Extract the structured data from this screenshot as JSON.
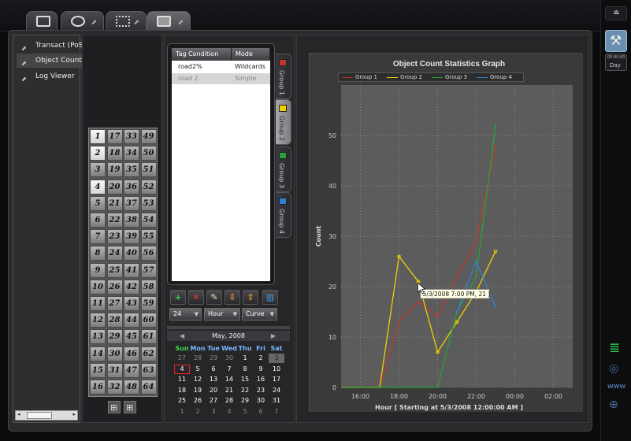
{
  "tabs": [
    {
      "id": "monitor",
      "icon": "monitor-icon",
      "active": false
    },
    {
      "id": "dashboard",
      "icon": "gauge-icon",
      "active": false
    },
    {
      "id": "network",
      "icon": "network-icon",
      "active": false
    },
    {
      "id": "window",
      "icon": "window-icon",
      "active": true
    }
  ],
  "sidebar": {
    "items": [
      {
        "label": "Transact (PoS"
      },
      {
        "label": "Object Count"
      },
      {
        "label": "Log Viewer"
      }
    ]
  },
  "channel_grid": [
    [
      "1",
      "17",
      "33",
      "49"
    ],
    [
      "2",
      "18",
      "34",
      "50"
    ],
    [
      "3",
      "19",
      "35",
      "51"
    ],
    [
      "4",
      "20",
      "36",
      "52"
    ],
    [
      "5",
      "21",
      "37",
      "53"
    ],
    [
      "6",
      "22",
      "38",
      "54"
    ],
    [
      "7",
      "23",
      "39",
      "55"
    ],
    [
      "8",
      "24",
      "40",
      "56"
    ],
    [
      "9",
      "25",
      "41",
      "57"
    ],
    [
      "10",
      "26",
      "42",
      "58"
    ],
    [
      "11",
      "27",
      "43",
      "59"
    ],
    [
      "12",
      "28",
      "44",
      "60"
    ],
    [
      "13",
      "29",
      "45",
      "61"
    ],
    [
      "14",
      "30",
      "46",
      "62"
    ],
    [
      "15",
      "31",
      "47",
      "63"
    ],
    [
      "16",
      "32",
      "48",
      "64"
    ]
  ],
  "tag_table": {
    "headers": [
      "Tag Condition",
      "Mode"
    ],
    "rows": [
      [
        "road2%",
        "Wildcards"
      ],
      [
        "road 2",
        "Simple"
      ]
    ]
  },
  "groups": [
    "Group 1",
    "Group 2",
    "Group 3",
    "Group 4"
  ],
  "group_colors": [
    "#c0392b",
    "#f0d000",
    "#27a33a",
    "#2f7fd8"
  ],
  "toolbar": {
    "dd_interval": "24",
    "dd_unit": "Hour",
    "dd_style": "Curve"
  },
  "calendar": {
    "month": "May, 2008",
    "dow": [
      "Sun",
      "Mon",
      "Tue",
      "Wed",
      "Thu",
      "Fri",
      "Sat"
    ],
    "weeks": [
      [
        "27",
        "28",
        "29",
        "30",
        "1",
        "2",
        "3"
      ],
      [
        "4",
        "5",
        "6",
        "7",
        "8",
        "9",
        "10"
      ],
      [
        "11",
        "12",
        "13",
        "14",
        "15",
        "16",
        "17"
      ],
      [
        "18",
        "19",
        "20",
        "21",
        "22",
        "23",
        "24"
      ],
      [
        "25",
        "26",
        "27",
        "28",
        "29",
        "30",
        "31"
      ],
      [
        "1",
        "2",
        "3",
        "4",
        "5",
        "6",
        "7"
      ]
    ]
  },
  "rightbar": {
    "clock": "00:00:00",
    "day": "Day"
  },
  "chart_data": {
    "type": "line",
    "title": "Object Count Statistics Graph",
    "xlabel": "Hour  [ Starting at 5/3/2008 12:00:00 AM ]",
    "ylabel": "Count",
    "x_ticks": [
      "16:00",
      "18:00",
      "20:00",
      "22:00",
      "00:00",
      "02:00"
    ],
    "y_ticks": [
      "0",
      "10",
      "20",
      "30",
      "40",
      "50"
    ],
    "ylim": [
      0,
      60
    ],
    "xlim_hours": [
      15,
      27
    ],
    "grid": true,
    "legend": "top",
    "tooltip": "5/3/2008 7:00 PM, 21 )",
    "series": [
      {
        "name": "Group 1",
        "color": "#c0392b",
        "points": [
          [
            15,
            0
          ],
          [
            17,
            0
          ],
          [
            18,
            13
          ],
          [
            19,
            17
          ],
          [
            20,
            14
          ],
          [
            21,
            22
          ],
          [
            22,
            29
          ],
          [
            23,
            48
          ]
        ]
      },
      {
        "name": "Group 2",
        "color": "#f0d000",
        "points": [
          [
            15,
            0
          ],
          [
            17,
            0
          ],
          [
            18,
            26
          ],
          [
            19,
            21
          ],
          [
            20,
            7
          ],
          [
            21,
            13
          ],
          [
            22,
            19
          ],
          [
            23,
            27
          ]
        ]
      },
      {
        "name": "Group 3",
        "color": "#27a33a",
        "points": [
          [
            15,
            0
          ],
          [
            20,
            0
          ],
          [
            21,
            15
          ],
          [
            22,
            22
          ],
          [
            23,
            52
          ]
        ]
      },
      {
        "name": "Group 4",
        "color": "#2f7fd8",
        "points": [
          [
            21,
            15
          ],
          [
            22,
            25
          ],
          [
            23,
            16
          ]
        ]
      }
    ]
  }
}
